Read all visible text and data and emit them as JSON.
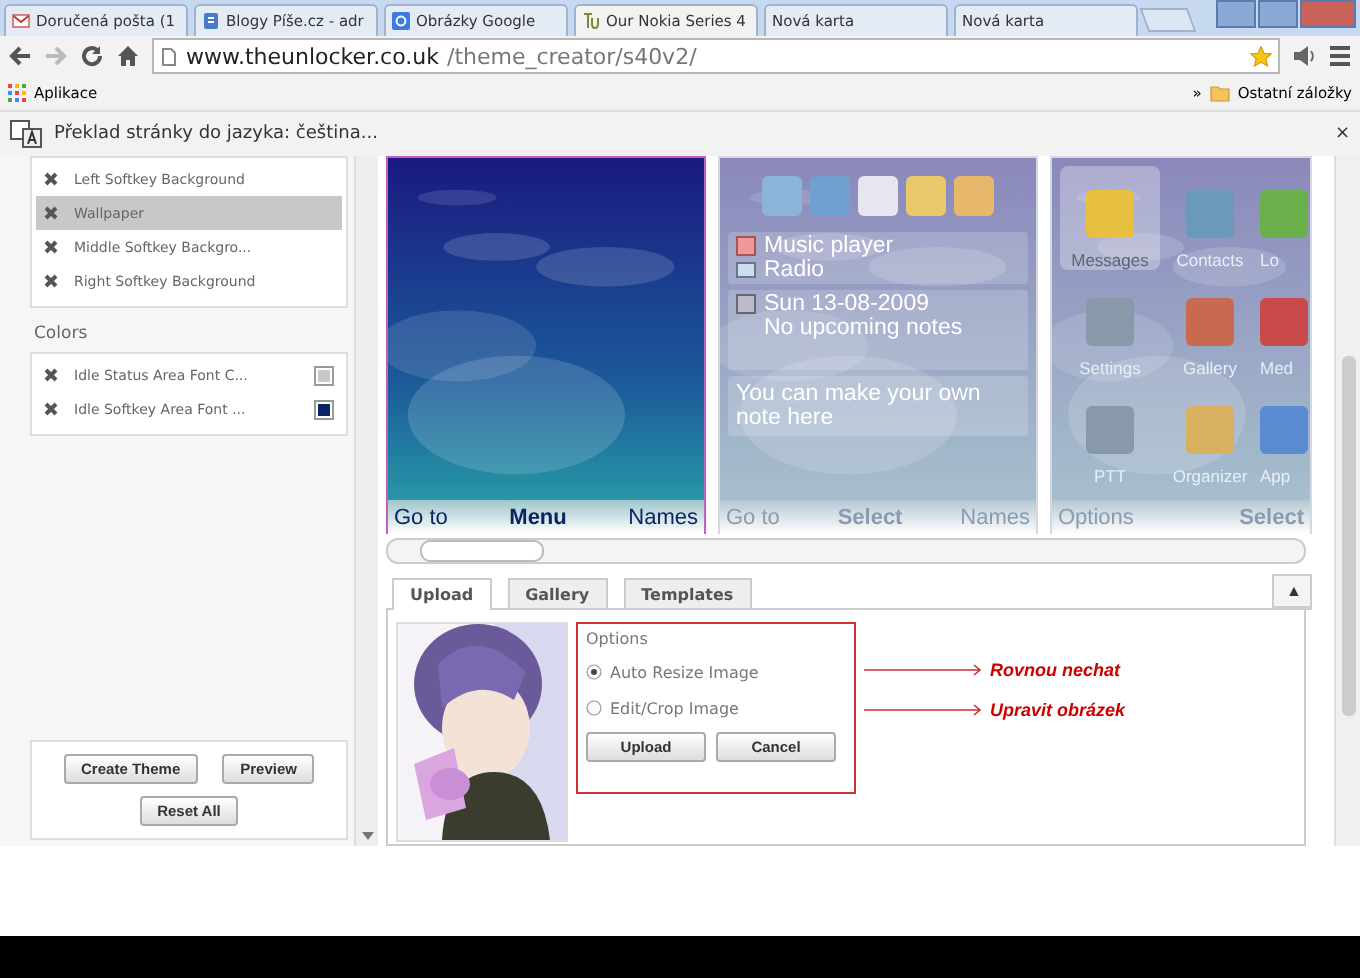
{
  "browser": {
    "tabs": [
      {
        "title": "Doručená pošta (1",
        "kind": "mail",
        "selected": false
      },
      {
        "title": "Blogy Píše.cz - adr",
        "kind": "blog",
        "selected": false
      },
      {
        "title": "Obrázky Google",
        "kind": "google",
        "selected": false
      },
      {
        "title": "Our Nokia Series 4",
        "kind": "tu",
        "selected": true
      },
      {
        "title": "Nová karta",
        "kind": "none",
        "selected": false
      },
      {
        "title": "Nová karta",
        "kind": "none",
        "selected": false
      }
    ],
    "address": {
      "host": "www.theunlocker.co.uk",
      "path": "/theme_creator/s40v2/"
    },
    "bookmarks": {
      "apps": "Aplikace",
      "more": "»",
      "other": "Ostatní záložky"
    },
    "translate_bar": {
      "text": "Překlad stránky do jazyka: čeština...",
      "close": "×"
    }
  },
  "sidebar": {
    "layers": [
      {
        "label": "Left Softkey Background",
        "selected": false
      },
      {
        "label": "Wallpaper",
        "selected": true
      },
      {
        "label": "Middle Softkey Backgro...",
        "selected": false
      },
      {
        "label": "Right Softkey Background",
        "selected": false
      }
    ],
    "colors_heading": "Colors",
    "colors": [
      {
        "label": "Idle Status Area Font C...",
        "color": "#c8c8c8"
      },
      {
        "label": "Idle Softkey Area Font ...",
        "color": "#0b2463"
      }
    ],
    "buttons": [
      "Create Theme",
      "Preview",
      "Reset All"
    ]
  },
  "previews": [
    {
      "kind": "idle",
      "selected": true,
      "softkeys": [
        "Go to",
        "Menu",
        "Names"
      ]
    },
    {
      "kind": "active",
      "selected": false,
      "items": [
        "Music player",
        "Radio"
      ],
      "date": "Sun 13-08-2009",
      "notes": "No upcoming notes",
      "note": "You can make your own note here",
      "softkeys": [
        "Go to",
        "Select",
        "Names"
      ]
    },
    {
      "kind": "grid",
      "selected": false,
      "apps": [
        {
          "label": "Messages",
          "selected": true
        },
        {
          "label": "Contacts",
          "selected": false
        },
        {
          "label": "Lo",
          "selected": false
        },
        {
          "label": "Settings",
          "selected": false
        },
        {
          "label": "Gallery",
          "selected": false
        },
        {
          "label": "Med",
          "selected": false
        },
        {
          "label": "PTT",
          "selected": false
        },
        {
          "label": "Organizer",
          "selected": false
        },
        {
          "label": "App",
          "selected": false
        }
      ],
      "softkeys": [
        "Options",
        "Select"
      ]
    }
  ],
  "panel": {
    "tabs": [
      {
        "label": "Upload",
        "selected": true
      },
      {
        "label": "Gallery",
        "selected": false
      },
      {
        "label": "Templates",
        "selected": false
      }
    ],
    "collapse": "▲",
    "image": {
      "kind": "picture"
    },
    "options_title": "Options",
    "options": [
      {
        "label": "Auto Resize Image",
        "selected": true,
        "note": "Rovnou nechat"
      },
      {
        "label": "Edit/Crop Image",
        "selected": false,
        "note": "Upravit obrázek"
      }
    ],
    "buttons": [
      "Upload",
      "Cancel"
    ]
  }
}
